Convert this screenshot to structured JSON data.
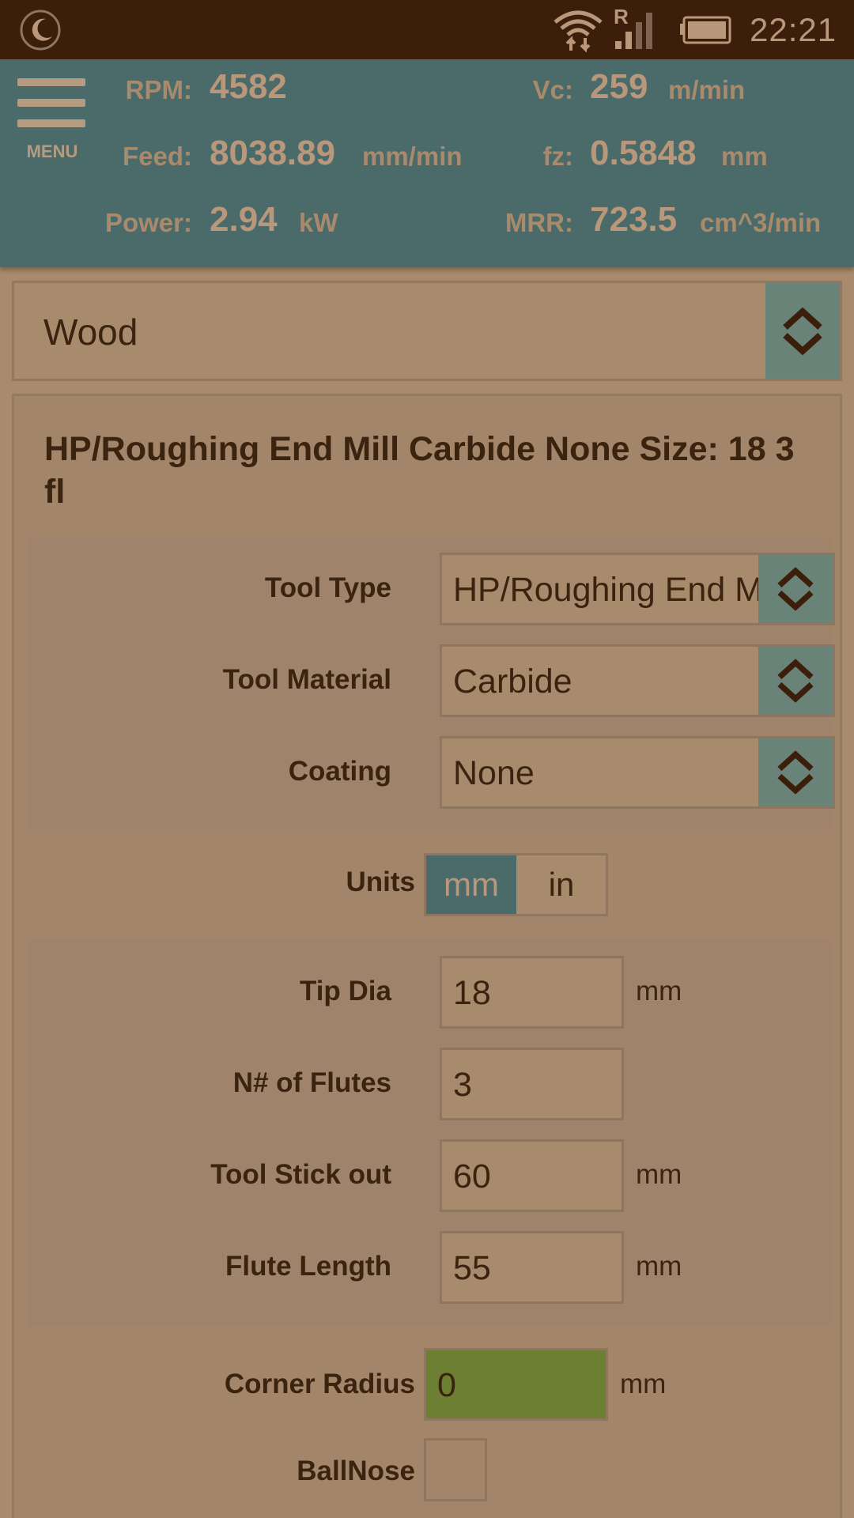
{
  "statusbar": {
    "network_letter": "R",
    "time": "22:21",
    "icons": [
      "moon-icon",
      "wifi-icon",
      "signal-icon",
      "battery-icon"
    ]
  },
  "header": {
    "menu_label": "MENU",
    "rpm": {
      "label": "RPM:",
      "value": "4582",
      "unit": ""
    },
    "vc": {
      "label": "Vc:",
      "value": "259",
      "unit": "m/min"
    },
    "feed": {
      "label": "Feed:",
      "value": "8038.89",
      "unit": "mm/min"
    },
    "fz": {
      "label": "fz:",
      "value": "0.5848",
      "unit": "mm"
    },
    "power": {
      "label": "Power:",
      "value": "2.94",
      "unit": "kW"
    },
    "mrr": {
      "label": "MRR:",
      "value": "723.5",
      "unit": "cm^3/min"
    }
  },
  "material": {
    "selected": "Wood"
  },
  "tool": {
    "title": "HP/Roughing End Mill Carbide None Size: 18 3 fl",
    "type": {
      "label": "Tool Type",
      "value": "HP/Roughing End Mill"
    },
    "material": {
      "label": "Tool Material",
      "value": "Carbide"
    },
    "coating": {
      "label": "Coating",
      "value": "None"
    },
    "units": {
      "label": "Units",
      "options": [
        "mm",
        "in"
      ],
      "selected": "mm"
    },
    "tip_dia": {
      "label": "Tip Dia",
      "value": "18",
      "unit": "mm"
    },
    "flutes": {
      "label": "N# of Flutes",
      "value": "3"
    },
    "stick_out": {
      "label": "Tool Stick out",
      "value": "60",
      "unit": "mm"
    },
    "flute_length": {
      "label": "Flute Length",
      "value": "55",
      "unit": "mm"
    },
    "corner_radius": {
      "label": "Corner Radius",
      "value": "0",
      "unit": "mm"
    },
    "ballnose": {
      "label": "BallNose",
      "checked": false
    }
  },
  "colors": {
    "statusbar": "#3b1f0a",
    "header": "#4b6b6b",
    "background": "#a88a6d",
    "spinner_button": "#6a8379",
    "highlight_input": "#6c7f32",
    "text_dark": "#3a2410"
  }
}
